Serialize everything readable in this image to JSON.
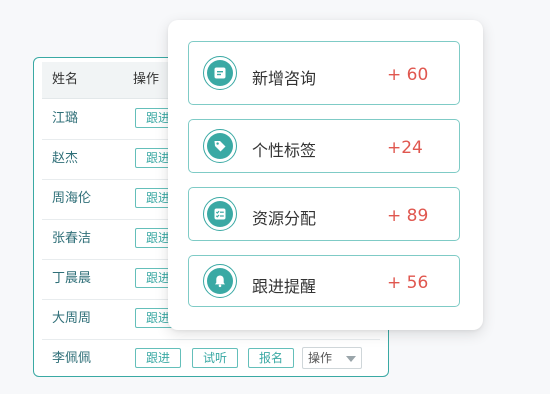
{
  "table": {
    "headers": {
      "name": "姓名",
      "operation": "操作"
    },
    "rows": [
      {
        "name": "江璐"
      },
      {
        "name": "赵杰"
      },
      {
        "name": "周海伦"
      },
      {
        "name": "张春洁"
      },
      {
        "name": "丁晨晨"
      },
      {
        "name": "大周周"
      },
      {
        "name": "李佩佩"
      }
    ],
    "actions": {
      "follow": "跟进",
      "trial": "试听",
      "signup": "报名",
      "select_value": "操作"
    }
  },
  "stats": [
    {
      "label": "新增咨询",
      "value": "+ 60",
      "icon": "message-icon"
    },
    {
      "label": "个性标签",
      "value": "+24",
      "icon": "tag-icon"
    },
    {
      "label": "资源分配",
      "value": "+ 89",
      "icon": "checklist-icon"
    },
    {
      "label": "跟进提醒",
      "value": "+ 56",
      "icon": "bell-icon"
    }
  ],
  "colors": {
    "accent": "#3aa9a4",
    "value_red": "#e0574f"
  }
}
